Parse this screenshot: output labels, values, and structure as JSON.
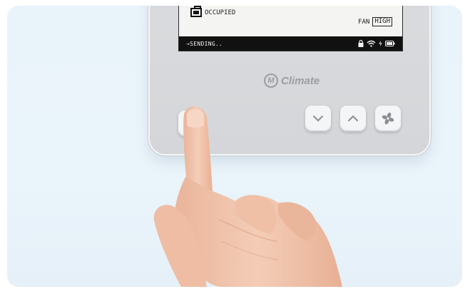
{
  "screen": {
    "occupancy_label": "OCCUPIED",
    "fan_label": "FAN",
    "fan_level": "HIGH",
    "status_text": "→SENDING.."
  },
  "brand": {
    "mark": "M",
    "name": "Climate"
  },
  "buttons": {
    "power": "power-icon",
    "down": "chevron-down-icon",
    "up": "chevron-up-icon",
    "fan": "fan-icon"
  },
  "colors": {
    "background": "#e9f3fa",
    "device": "#d9dbde",
    "screen": "#f4f4f2",
    "status_bar": "#111111",
    "skin": "#f1c4ad"
  }
}
